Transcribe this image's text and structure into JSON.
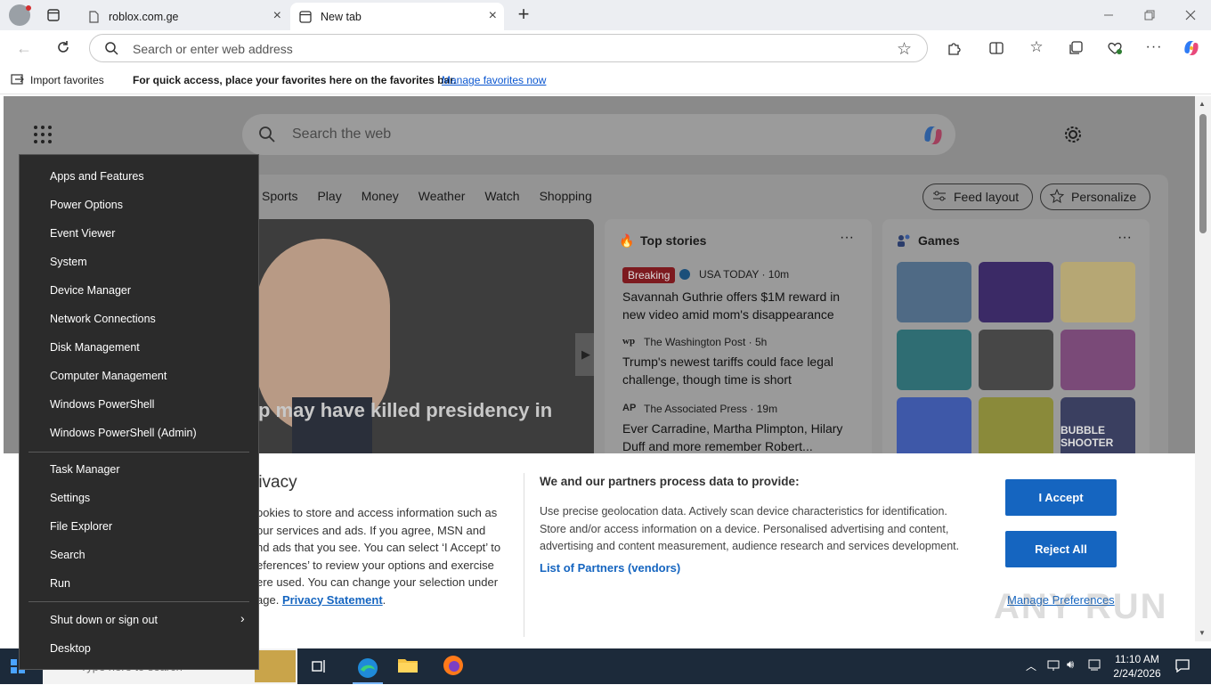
{
  "browser": {
    "tabs": [
      {
        "title": "roblox.com.ge"
      },
      {
        "title": "New tab"
      }
    ],
    "address_placeholder": "Search or enter web address"
  },
  "favorites_bar": {
    "import_label": "Import favorites",
    "message": "For quick access, place your favorites here on the favorites bar.",
    "manage_link": "Manage favorites now"
  },
  "newtab": {
    "search_placeholder": "Search the web",
    "nav": [
      "Sports",
      "Play",
      "Money",
      "Weather",
      "Watch",
      "Shopping"
    ],
    "feed_layout_label": "Feed layout",
    "personalize_label": "Personalize",
    "hero_headline": "p may have killed presidency in",
    "top_stories": {
      "title": "Top stories",
      "items": [
        {
          "badge": "Breaking",
          "source": "USA TODAY · 10m",
          "headline": "Savannah Guthrie offers $1M reward in new video amid mom's disappearance"
        },
        {
          "source": "The Washington Post · 5h",
          "headline": "Trump's newest tariffs could face legal challenge, though time is short"
        },
        {
          "source": "The Associated Press · 19m",
          "headline": "Ever Carradine, Martha Plimpton, Hilary Duff and more remember Robert..."
        }
      ]
    },
    "games": {
      "title": "Games",
      "tile_text": "BUBBLE SHOOTER"
    }
  },
  "privacy": {
    "title": "rivacy",
    "body_lines": [
      "ookies to store and access information such as",
      "our services and ads. If you agree, MSN and",
      "nd ads that you see. You can select ‘I Accept’ to",
      "eferences’ to review your options and exercise",
      "ere used.  You can change your selection under",
      "age."
    ],
    "privacy_link": "Privacy Statement",
    "partners_title": "We and our partners process data to provide:",
    "partners_text": [
      "Use precise geolocation data. Actively scan device characteristics for identification.",
      "Store and/or access information on a device. Personalised advertising and content,",
      "advertising and content measurement, audience research and services development."
    ],
    "partners_link": "List of Partners (vendors)",
    "accept": "I Accept",
    "reject": "Reject All",
    "manage": "Manage Preferences"
  },
  "context_menu": {
    "group1": [
      "Apps and Features",
      "Power Options",
      "Event Viewer",
      "System",
      "Device Manager",
      "Network Connections",
      "Disk Management",
      "Computer Management",
      "Windows PowerShell",
      "Windows PowerShell (Admin)"
    ],
    "group2": [
      "Task Manager",
      "Settings",
      "File Explorer",
      "Search",
      "Run"
    ],
    "group3": [
      "Shut down or sign out",
      "Desktop"
    ]
  },
  "taskbar": {
    "search_placeholder": "Type here to search",
    "time": "11:10 AM",
    "date": "2/24/2026"
  },
  "watermark": "ANY RUN",
  "colors": {
    "accent": "#1565c0",
    "breaking": "#c4262e",
    "taskbar": "#1c2a3a"
  }
}
